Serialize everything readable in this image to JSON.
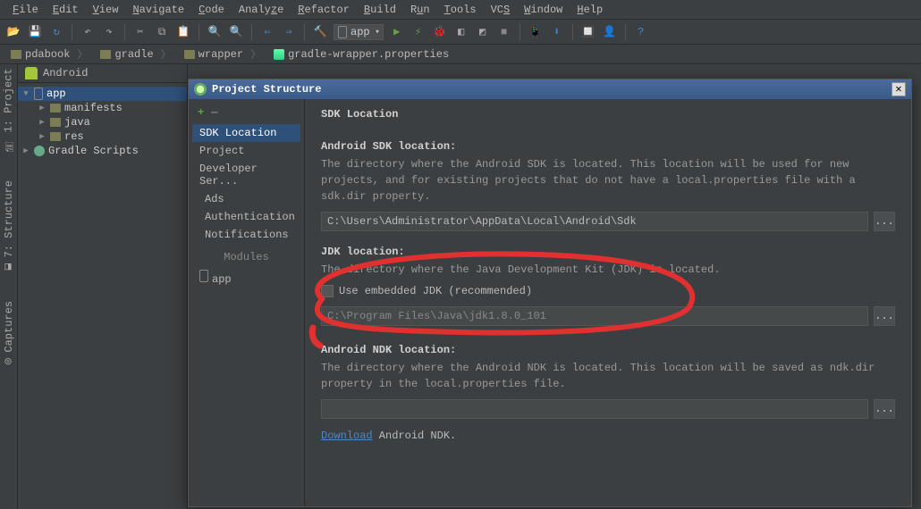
{
  "menu": [
    "File",
    "Edit",
    "View",
    "Navigate",
    "Code",
    "Analyze",
    "Refactor",
    "Build",
    "Run",
    "Tools",
    "VCS",
    "Window",
    "Help"
  ],
  "toolbar": {
    "combo": "app"
  },
  "breadcrumb": [
    "pdabook",
    "gradle",
    "wrapper",
    "gradle-wrapper.properties"
  ],
  "gutter": {
    "project": "1: Project",
    "structure": "7: Structure",
    "captures": "Captures"
  },
  "proj": {
    "header": "Android",
    "app": "app",
    "manifests": "manifests",
    "java": "java",
    "res": "res",
    "gradle": "Gradle Scripts"
  },
  "dialog": {
    "title": "Project Structure",
    "nav": {
      "sdk": "SDK Location",
      "project": "Project",
      "dev": "Developer Ser...",
      "ads": "Ads",
      "auth": "Authentication",
      "notif": "Notifications",
      "modules": "Modules",
      "app": "app"
    },
    "content": {
      "heading": "SDK Location",
      "sdk_label": "Android SDK location:",
      "sdk_desc": "The directory where the Android SDK is located. This location will be used for new projects, and for existing projects that do not have a local.properties file with a sdk.dir property.",
      "sdk_path": "C:\\Users\\Administrator\\AppData\\Local\\Android\\Sdk",
      "jdk_label": "JDK location:",
      "jdk_desc": "The directory where the Java Development Kit (JDK) is located.",
      "jdk_embed": "Use embedded JDK (recommended)",
      "jdk_path": "C:\\Program Files\\Java\\jdk1.8.0_101",
      "ndk_label": "Android NDK location:",
      "ndk_desc": "The directory where the Android NDK is located. This location will be saved as ndk.dir property in the local.properties file.",
      "ndk_path": "",
      "download": "Download",
      "ndk_tail": " Android NDK."
    }
  }
}
